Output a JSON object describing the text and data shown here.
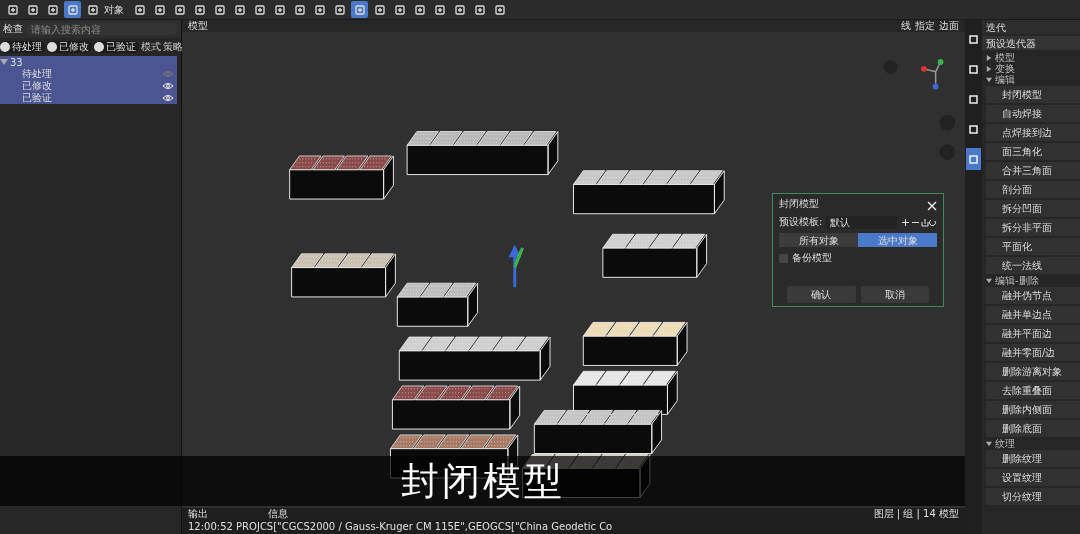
{
  "toolbar": {
    "object_label": "对象"
  },
  "inspector": {
    "title": "检查",
    "search": {
      "placeholder": "请输入搜索内容"
    },
    "filters": [
      {
        "label": "待处理",
        "on": false
      },
      {
        "label": "已修改",
        "on": false
      },
      {
        "label": "已验证",
        "on": false
      }
    ],
    "mode_label": "模式",
    "strategy_label": "策略",
    "tree": {
      "label": "33",
      "expanded": true,
      "children": [
        {
          "label": "待处理",
          "visible": false
        },
        {
          "label": "已修改",
          "visible": true
        },
        {
          "label": "已验证",
          "visible": true
        }
      ]
    }
  },
  "viewport": {
    "view_label": "模型",
    "toolbar_labels": [
      "线",
      "指定",
      "边面"
    ],
    "dialog": {
      "title": "封闭模型",
      "preset_label": "预设模板:",
      "preset_value": "默认",
      "segments": [
        {
          "label": "所有对象",
          "selected": false
        },
        {
          "label": "选中对象",
          "selected": true
        }
      ],
      "backup": {
        "label": "备份模型",
        "checked": false
      },
      "buttons": [
        "确认",
        "取消"
      ]
    }
  },
  "side_tabs": [
    {
      "selected": false
    },
    {
      "selected": false
    },
    {
      "selected": false
    },
    {
      "selected": false
    },
    {
      "selected": true
    }
  ],
  "iterate_panel": {
    "title": "迭代",
    "preset": "预设迭代器",
    "sections": [
      {
        "label": "模型",
        "expanded": false
      },
      {
        "label": "变换",
        "expanded": false
      },
      {
        "label": "编辑",
        "expanded": true,
        "items": [
          "封闭模型",
          "自动焊接",
          "点焊接到边",
          "面三角化",
          "合并三角面",
          "剖分面",
          "拆分凹面",
          "拆分非平面",
          "平面化",
          "统一法线"
        ]
      },
      {
        "label": "编辑-删除",
        "expanded": true,
        "items": [
          "融并伪节点",
          "融并单边点",
          "融并平面边",
          "融并零面/边",
          "删除游离对象",
          "去除重叠面",
          "删除内侧面",
          "删除底面"
        ]
      },
      {
        "label": "纹理",
        "expanded": true,
        "items": [
          "删除纹理",
          "设置纹理",
          "切分纹理"
        ]
      }
    ]
  },
  "caption": "封闭模型",
  "output": {
    "tab": "输出",
    "info": "信息",
    "log": "12:00:52 PROJCS[\"CGCS2000 / Gauss-Kruger CM 115E\",GEOGCS[\"China Geodetic Co",
    "stats": "图层 | 组 | 14 模型"
  }
}
